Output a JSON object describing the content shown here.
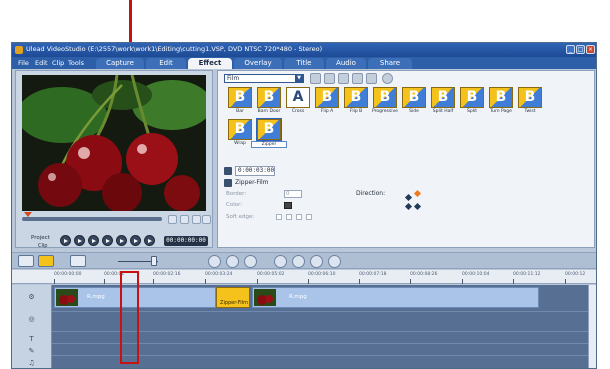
{
  "window": {
    "title": "Ulead VideoStudio (E:\\2557\\work\\work1\\Editing\\cutting1.VSP, DVD NTSC 720*480 - Stereo)"
  },
  "menu": {
    "items": [
      "File",
      "Edit",
      "Clip",
      "Tools"
    ]
  },
  "tabs": [
    {
      "label": "Capture",
      "active": false
    },
    {
      "label": "Edit",
      "active": false
    },
    {
      "label": "Effect",
      "active": true
    },
    {
      "label": "Overlay",
      "active": false
    },
    {
      "label": "Title",
      "active": false
    },
    {
      "label": "Audio",
      "active": false
    },
    {
      "label": "Share",
      "active": false
    }
  ],
  "preview": {
    "project_label": "Project",
    "clip_label": "Clip",
    "timecode": "00:00:00:00"
  },
  "library": {
    "category": "Film",
    "effects": [
      {
        "name": "Bar",
        "glyph": "B",
        "selected": false
      },
      {
        "name": "Barn Door",
        "glyph": "B",
        "selected": false
      },
      {
        "name": "Cross",
        "glyph": "A",
        "selected": false
      },
      {
        "name": "Flip A",
        "glyph": "B",
        "selected": false
      },
      {
        "name": "Flip B",
        "glyph": "B",
        "selected": false
      },
      {
        "name": "Progressive",
        "glyph": "B",
        "selected": false
      },
      {
        "name": "Side",
        "glyph": "B",
        "selected": false
      },
      {
        "name": "Split Half",
        "glyph": "B",
        "selected": false
      },
      {
        "name": "Split",
        "glyph": "B",
        "selected": false
      },
      {
        "name": "Turn Page",
        "glyph": "B",
        "selected": false
      },
      {
        "name": "Twist",
        "glyph": "B",
        "selected": false
      },
      {
        "name": "Wrap",
        "glyph": "B",
        "selected": false
      },
      {
        "name": "Zipper",
        "glyph": "B",
        "selected": true
      }
    ]
  },
  "options": {
    "duration": "0:00:03:00",
    "effect_name": "Zipper-Film",
    "border_label": "Border:",
    "border_value": "0",
    "color_label": "Color:",
    "soft_edge_label": "Soft edge:",
    "direction_label": "Direction:",
    "colors": {
      "swatch": "#444444",
      "direction_active": "#f07a1a"
    }
  },
  "ruler": {
    "marks": [
      "00:00:00:00",
      "00:00:01",
      "00:00:02:16",
      "00:00:03:24",
      "00:00:05:02",
      "00:00:06:10",
      "00:00:07:18",
      "00:00:08:26",
      "00:00:10:04",
      "00:00:11:12",
      "00:00:12"
    ]
  },
  "timeline": {
    "clip1_name": "R.mpg",
    "clip2_name": "R.mpg",
    "transition_label": "Zipper-Film"
  }
}
